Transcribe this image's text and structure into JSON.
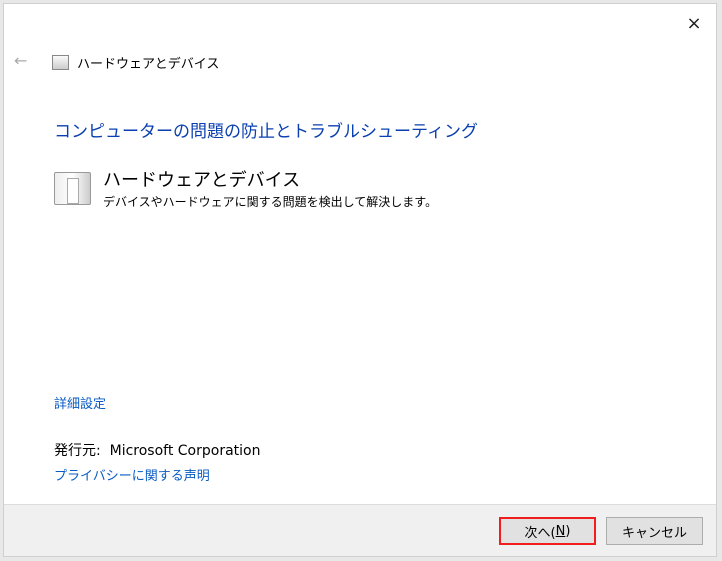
{
  "window": {
    "close_icon": "×",
    "back_icon": "←",
    "header_title": "ハードウェアとデバイス"
  },
  "main": {
    "title": "コンピューターの問題の防止とトラブルシューティング",
    "item": {
      "title": "ハードウェアとデバイス",
      "description": "デバイスやハードウェアに関する問題を検出して解決します。"
    },
    "advanced_link": "詳細設定",
    "publisher_label": "発行元:",
    "publisher": "Microsoft Corporation",
    "privacy_link": "プライバシーに関する声明"
  },
  "footer": {
    "next_prefix": "次へ(",
    "next_key": "N",
    "next_suffix": ")",
    "cancel": "キャンセル"
  }
}
